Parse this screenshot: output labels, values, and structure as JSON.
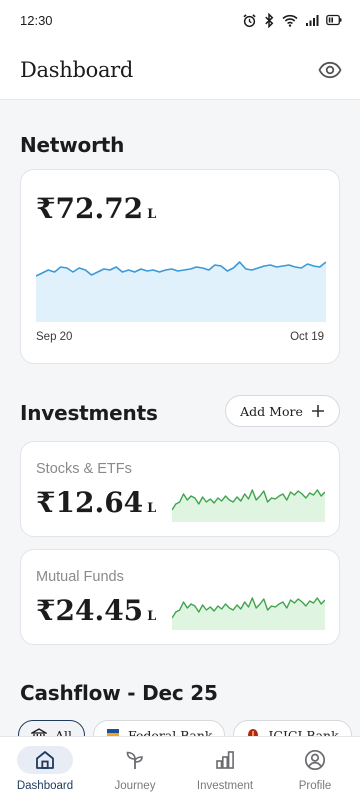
{
  "status_bar": {
    "time": "12:30"
  },
  "header": {
    "title": "Dashboard"
  },
  "networth": {
    "section_title": "Networth",
    "currency": "₹",
    "amount": "₹72.72",
    "unit": "L",
    "start_label": "Sep 20",
    "end_label": "Oct 19",
    "line_color": "#3a9ad9",
    "fill_color": "#e1f1fc"
  },
  "investments": {
    "section_title": "Investments",
    "add_more_label": "Add More",
    "items": [
      {
        "label": "Stocks & ETFs",
        "amount": "₹12.64",
        "unit": "L"
      },
      {
        "label": "Mutual Funds",
        "amount": "₹24.45",
        "unit": "L"
      }
    ],
    "line_color": "#3fa34d",
    "fill_color": "#dff5e1"
  },
  "cashflow": {
    "section_title": "Cashflow - Dec 25",
    "chips": [
      {
        "label": "All",
        "active": true
      },
      {
        "label": "Federal Bank",
        "active": false
      },
      {
        "label": "ICICI Bank",
        "active": false
      }
    ]
  },
  "bottom_nav": {
    "items": [
      {
        "label": "Dashboard",
        "icon": "home-icon",
        "active": true
      },
      {
        "label": "Journey",
        "icon": "sprout-icon",
        "active": false
      },
      {
        "label": "Investment",
        "icon": "bar-chart-icon",
        "active": false
      },
      {
        "label": "Profile",
        "icon": "profile-icon",
        "active": false
      }
    ]
  }
}
